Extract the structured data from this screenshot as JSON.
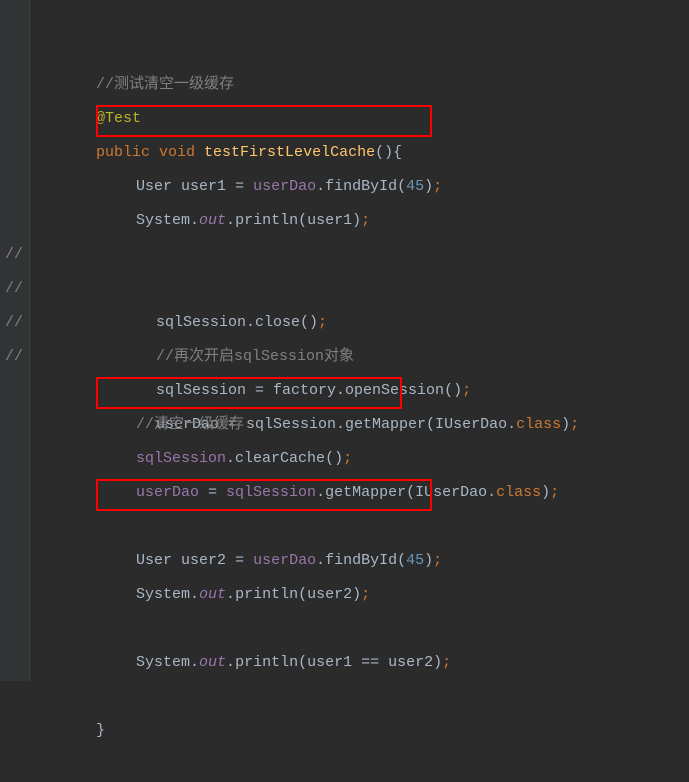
{
  "lines": {
    "l1": {
      "comment": "//测试清空一级缓存"
    },
    "l2": {
      "annotation": "@Test"
    },
    "l3": {
      "kw1": "public ",
      "kw2": "void ",
      "method": "testFirstLevelCache",
      "paren": "()",
      "brace": "{"
    },
    "l4": {
      "type": "User ",
      "var": "user1 ",
      "eq": "= ",
      "obj": "userDao",
      "dot": ".",
      "call": "findById",
      "open": "(",
      "num": "45",
      "close": ")",
      "semi": ";"
    },
    "l5": {
      "sys": "System.",
      "out": "out",
      "dot": ".",
      "call": "println(user1)",
      "semi": ";"
    },
    "l6": {
      "empty": ""
    },
    "l7": {
      "gc": "//",
      "code": "sqlSession.close()",
      "semi": ";"
    },
    "l8": {
      "gc": "//",
      "comment": "//再次开启sqlSession对象"
    },
    "l9": {
      "gc": "//",
      "code": "sqlSession = factory.openSession()",
      "semi": ";"
    },
    "l10": {
      "gc": "//",
      "code": "userDao = sqlSession.getMapper(IUserDao.",
      "kw": "class",
      "close": ")",
      "semi": ";"
    },
    "l11": {
      "comment": "//清空一级缓存"
    },
    "l12": {
      "obj": "sqlSession",
      "dot": ".",
      "call": "clearCache",
      "paren": "()",
      "semi": ";"
    },
    "l13": {
      "var": "userDao ",
      "eq": "= ",
      "obj": "sqlSession",
      "dot": ".",
      "call": "getMapper",
      "open": "(",
      "cls": "IUserDao.",
      "kw": "class",
      "close": ")",
      "semi": ";"
    },
    "l14": {
      "empty": ""
    },
    "l15": {
      "type": "User ",
      "var": "user2 ",
      "eq": "= ",
      "obj": "userDao",
      "dot": ".",
      "call": "findById",
      "open": "(",
      "num": "45",
      "close": ")",
      "semi": ";"
    },
    "l16": {
      "sys": "System.",
      "out": "out",
      "dot": ".",
      "call": "println(user2)",
      "semi": ";"
    },
    "l17": {
      "empty": ""
    },
    "l18": {
      "sys": "System.",
      "out": "out",
      "dot": ".",
      "call": "println(user1 == user2)",
      "semi": ";"
    },
    "l19": {
      "empty": ""
    },
    "l20": {
      "brace": "}"
    }
  }
}
